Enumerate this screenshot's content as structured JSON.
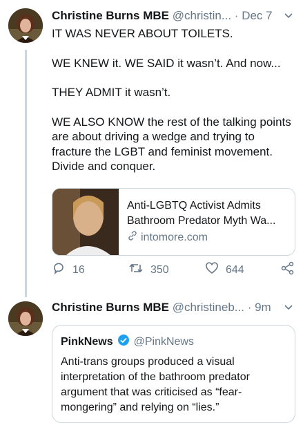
{
  "tweet1": {
    "name": "Christine Burns MBE",
    "handle": "@christin...",
    "dot": "·",
    "time": "Dec 7",
    "paragraphs": [
      "IT WAS NEVER ABOUT TOILETS.",
      "WE KNEW it. WE SAID it wasn’t. And now...",
      "THEY ADMIT it wasn’t.",
      "WE ALSO KNOW the rest of the talking points are about driving a wedge and trying to fracture the LGBT and feminist movement. Divide and conquer."
    ],
    "card": {
      "title_line1": "Anti-LGBTQ Activist Admits",
      "title_line2": "Bathroom Predator Myth Wa...",
      "domain": "intomore.com"
    },
    "actions": {
      "replies": "16",
      "retweets": "350",
      "likes": "644"
    }
  },
  "tweet2": {
    "name": "Christine Burns MBE",
    "handle": "@christineb...",
    "dot": "·",
    "time": "9m",
    "quote": {
      "name": "PinkNews",
      "handle": "@PinkNews",
      "text": "Anti-trans groups produced a visual interpretation of the bathroom predator argument that was criticised as “fear-mongering” and relying on “lies.”"
    }
  },
  "colors": {
    "text": "#14171a",
    "secondary": "#657786",
    "border": "#ccd6dd",
    "verified": "#1da1f2"
  }
}
